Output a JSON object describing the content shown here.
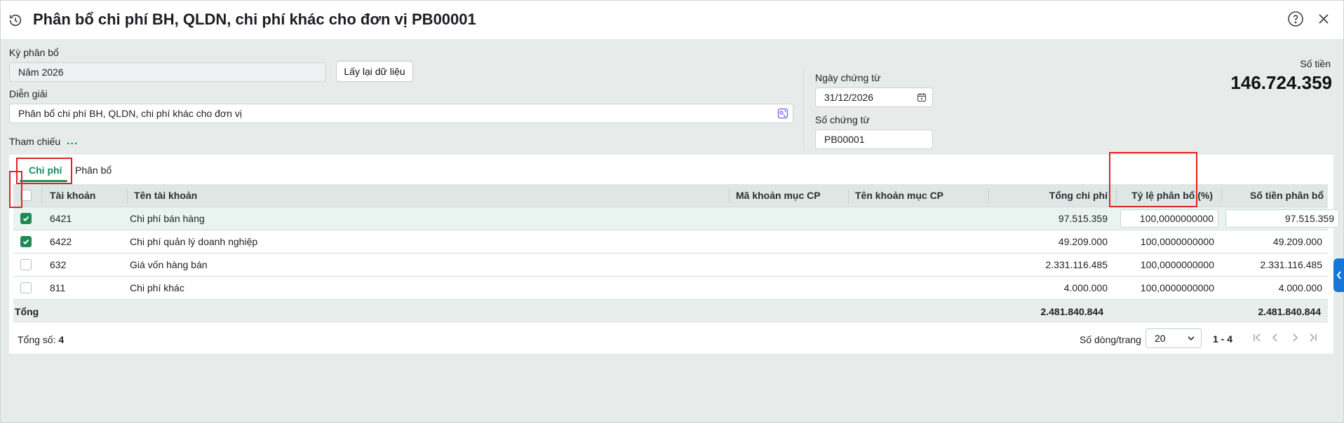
{
  "header": {
    "title": "Phân bổ chi phí BH, QLDN, chi phí khác cho đơn vị PB00001"
  },
  "form": {
    "period_label": "Kỳ phân bổ",
    "period_value": "Năm 2026",
    "reload_button": "Lấy lại dữ liệu",
    "description_label": "Diễn giải",
    "description_value": "Phân bổ chi phí BH, QLDN, chi phí khác cho đơn vị",
    "reference_label": "Tham chiếu",
    "reference_more": "...",
    "doc_date_label": "Ngày chứng từ",
    "doc_date_value": "31/12/2026",
    "doc_no_label": "Số chứng từ",
    "doc_no_value": "PB00001",
    "amount_label": "Số tiền",
    "amount_value": "146.724.359"
  },
  "tabs": [
    {
      "label": "Chi phí",
      "active": true
    },
    {
      "label": "Phân bổ",
      "active": false
    }
  ],
  "table": {
    "columns": [
      "Tài khoản",
      "Tên tài khoản",
      "Mã khoản mục CP",
      "Tên khoản mục CP",
      "Tổng chi phí",
      "Tỷ lệ phân bổ (%)",
      "Số tiền phân bổ"
    ],
    "rows": [
      {
        "checked": true,
        "account": "6421",
        "name": "Chi phí bán hàng",
        "code": "",
        "item": "",
        "total": "97.515.359",
        "rate": "100,0000000000",
        "allocated": "97.515.359"
      },
      {
        "checked": true,
        "account": "6422",
        "name": "Chi phí quản lý doanh nghiệp",
        "code": "",
        "item": "",
        "total": "49.209.000",
        "rate": "100,0000000000",
        "allocated": "49.209.000"
      },
      {
        "checked": false,
        "account": "632",
        "name": "Giá vốn hàng bán",
        "code": "",
        "item": "",
        "total": "2.331.116.485",
        "rate": "100,0000000000",
        "allocated": "2.331.116.485"
      },
      {
        "checked": false,
        "account": "811",
        "name": "Chi phí khác",
        "code": "",
        "item": "",
        "total": "4.000.000",
        "rate": "100,0000000000",
        "allocated": "4.000.000"
      }
    ],
    "total_label": "Tổng",
    "total_cost": "2.481.840.844",
    "total_allocated": "2.481.840.844"
  },
  "footer": {
    "count_label": "Tổng số:",
    "count_value": "4",
    "rows_per_page_label": "Số dòng/trang",
    "rows_per_page_value": "20",
    "range": "1 - 4"
  },
  "colors": {
    "accent": "#1a8f5c",
    "highlight": "#e02424",
    "side_tab": "#1677d8"
  }
}
